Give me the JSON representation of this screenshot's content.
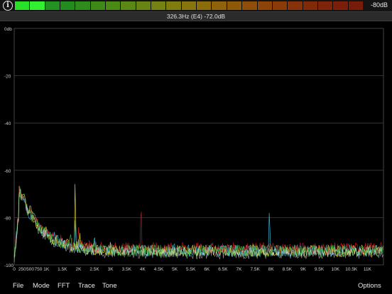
{
  "meter": {
    "readout": "-80dB",
    "segment_colors": [
      "#22c322",
      "#2bd02b",
      "#2cc82c",
      "#2fbe27",
      "#3fbe22",
      "#52bd1f",
      "#66bc1c",
      "#7ab91a",
      "#8eb618",
      "#9eb115",
      "#aeaa12",
      "#b9a010",
      "#bf940e",
      "#c3870c",
      "#c4780b",
      "#c36a0a",
      "#c15c09",
      "#bd4f09",
      "#b84309",
      "#b23809",
      "#ad2f09",
      "#a82809",
      "#a42309"
    ],
    "lit_segments": 2
  },
  "status": {
    "text": "326.3Hz (E4) -72.0dB"
  },
  "chart_data": {
    "type": "line",
    "xlabel": "",
    "ylabel": "",
    "x_ticks": [
      "0",
      "250",
      "500",
      "750",
      "1K",
      "1.5K",
      "2K",
      "2.5K",
      "3K",
      "3.5K",
      "4K",
      "4.5K",
      "5K",
      "5.5K",
      "6K",
      "6.5K",
      "7K",
      "7.5K",
      "8K",
      "8.5K",
      "9K",
      "9.5K",
      "10K",
      "10.5K",
      "11K"
    ],
    "y_ticks": [
      "0db",
      "-20",
      "-40",
      "-60",
      "-80",
      "-100"
    ],
    "ylim": [
      -100,
      0
    ],
    "xlim": [
      0,
      11500
    ],
    "grid": true,
    "series": [
      {
        "color": "#e8e030",
        "noise_floor": -94,
        "peaks": [
          [
            300,
            -70
          ],
          [
            500,
            -75
          ],
          [
            1000,
            -83
          ],
          [
            1900,
            -56
          ],
          [
            2050,
            -86
          ],
          [
            3000,
            -89
          ],
          [
            5000,
            -92
          ]
        ]
      },
      {
        "color": "#40c0e0",
        "noise_floor": -94,
        "peaks": [
          [
            300,
            -72
          ],
          [
            600,
            -78
          ],
          [
            1250,
            -86
          ],
          [
            1900,
            -76
          ],
          [
            2500,
            -86
          ],
          [
            5000,
            -91
          ],
          [
            7950,
            -71
          ]
        ]
      },
      {
        "color": "#c02020",
        "noise_floor": -93,
        "peaks": [
          [
            300,
            -71
          ],
          [
            500,
            -77
          ],
          [
            1000,
            -84
          ],
          [
            2000,
            -84
          ],
          [
            3950,
            -67
          ],
          [
            6000,
            -91
          ]
        ]
      },
      {
        "color": "#40c040",
        "noise_floor": -94,
        "peaks": [
          [
            300,
            -70
          ],
          [
            650,
            -80
          ],
          [
            1000,
            -85
          ],
          [
            1750,
            -84
          ],
          [
            2500,
            -88
          ],
          [
            4500,
            -92
          ]
        ]
      },
      {
        "color": "#ffffff",
        "noise_floor": -95,
        "peaks": [
          [
            300,
            -73
          ],
          [
            600,
            -80
          ],
          [
            1000,
            -87
          ],
          [
            2000,
            -89
          ],
          [
            3000,
            -92
          ]
        ]
      }
    ]
  },
  "toolbar": {
    "file": "File",
    "mode": "Mode",
    "fft": "FFT",
    "trace": "Trace",
    "tone": "Tone",
    "options": "Options"
  }
}
